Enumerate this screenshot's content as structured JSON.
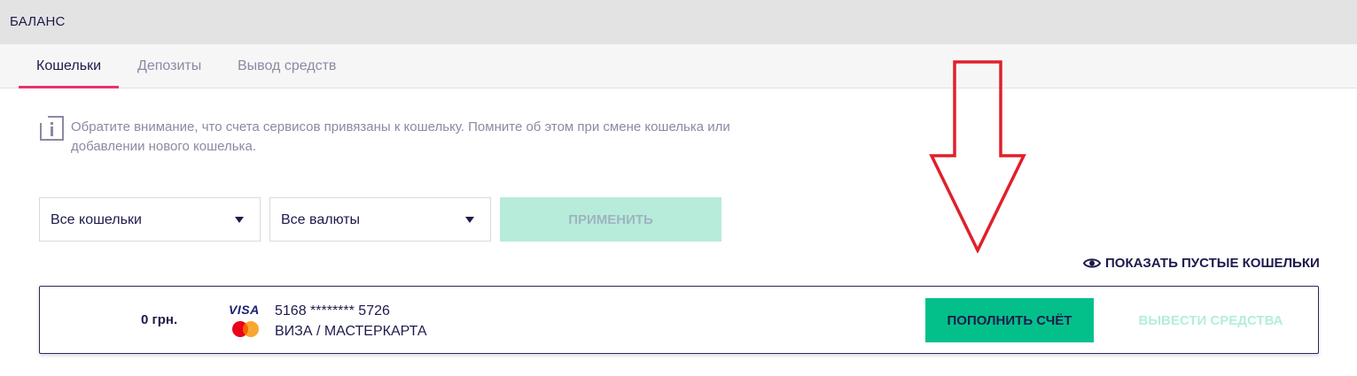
{
  "header": {
    "title": "БАЛАНС"
  },
  "tabs": [
    {
      "label": "Кошельки",
      "active": true
    },
    {
      "label": "Депозиты",
      "active": false
    },
    {
      "label": "Вывод средств",
      "active": false
    }
  ],
  "notice": {
    "icon": "info-icon",
    "text": "Обратите внимание, что счета сервисов привязаны к кошельку. Помните об этом при смене кошелька или добавлении нового кошелька."
  },
  "filters": {
    "wallet_select": {
      "value": "Все кошельки",
      "icon": "caret-down-icon"
    },
    "currency_select": {
      "value": "Все валюты",
      "icon": "caret-down-icon"
    },
    "apply_label": "ПРИМЕНИТЬ"
  },
  "show_empty": {
    "label": "ПОКАЗАТЬ ПУСТЫЕ КОШЕЛЬКИ",
    "icon": "eye-icon"
  },
  "wallet": {
    "amount": "0 грн.",
    "visa_logo": "VISA",
    "card_number": "5168 ******** 5726",
    "card_type": "ВИЗА / МАСТЕРКАРТА",
    "topup_label": "ПОПОЛНИТЬ СЧЁТ",
    "withdraw_label": "ВЫВЕСТИ СРЕДСТВА"
  },
  "colors": {
    "accent_pink": "#e8336e",
    "primary_green": "#03c08a",
    "disabled_green": "#b7ecda",
    "text_dark": "#1d1b4c",
    "annotation_red": "#e0202a"
  }
}
